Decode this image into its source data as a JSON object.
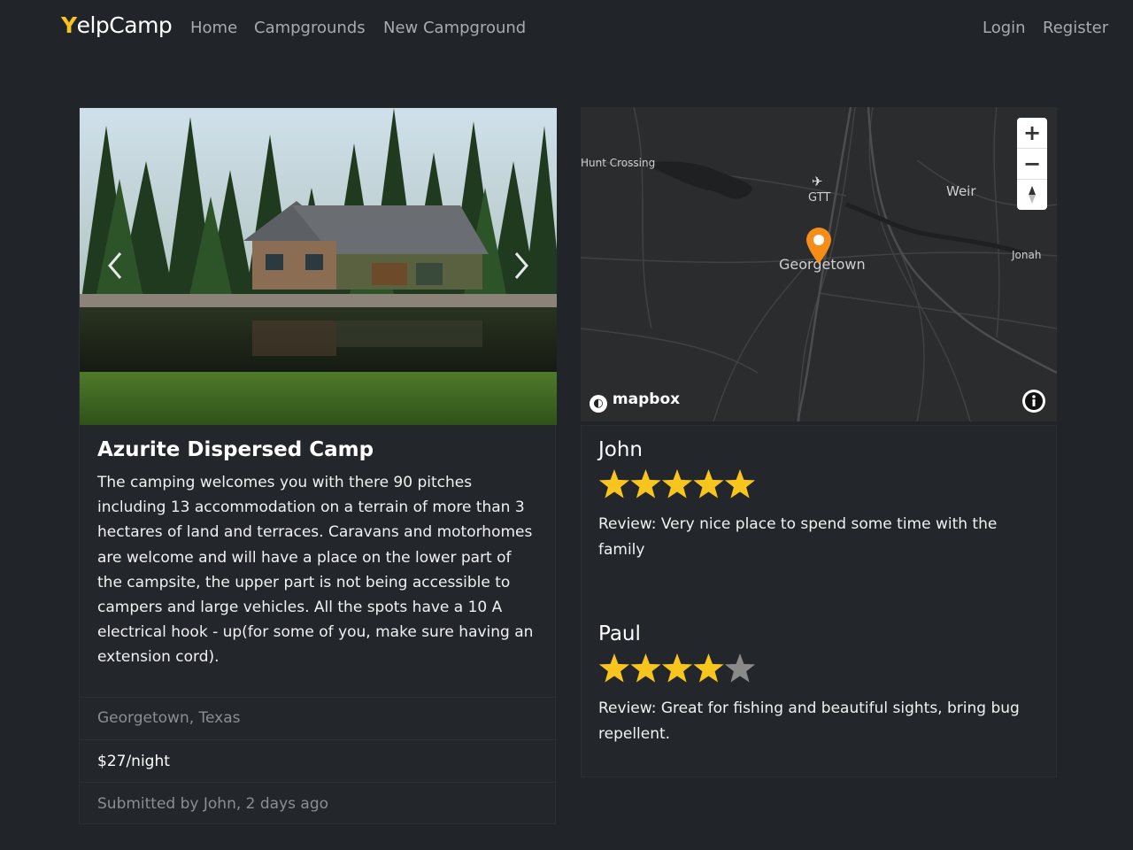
{
  "navbar": {
    "brand": "YelpCamp",
    "links": [
      "Home",
      "Campgrounds",
      "New Campground"
    ],
    "auth": [
      "Login",
      "Register"
    ]
  },
  "campground": {
    "title": "Azurite Dispersed Camp",
    "description": "The camping welcomes you with there 90 pitches including 13 accommodation on a terrain of more than 3 hectares of land and terraces. Caravans and motorhomes are welcome and will have a place on the lower part of the campsite, the upper part is not being accessible to campers and large vehicles. All the spots have a 10 A electrical hook - up(for some of you, make sure having an extension cord).",
    "location": "Georgetown, Texas",
    "price": "$27/night",
    "submitted": "Submitted by John, 2 days ago"
  },
  "map": {
    "labels": {
      "hunt_crossing": "Hunt Crossing",
      "gtt": "GTT",
      "weir": "Weir",
      "georgetown": "Georgetown",
      "jonah": "Jonah"
    },
    "attribution": "mapbox",
    "controls": [
      "zoom-in",
      "zoom-out",
      "compass",
      "info"
    ],
    "marker_color": "#f68d19"
  },
  "reviews": [
    {
      "author": "John",
      "rating": 5,
      "max": 5,
      "text": "Review: Very nice place to spend some time with the family"
    },
    {
      "author": "Paul",
      "rating": 4,
      "max": 5,
      "text": "Review: Great for fishing and beautiful sights, bring bug repellent."
    }
  ],
  "colors": {
    "background": "#212429",
    "brand_accent": "#f7c51e",
    "star": "#f7c51e",
    "star_empty": "#8a8a8a"
  }
}
